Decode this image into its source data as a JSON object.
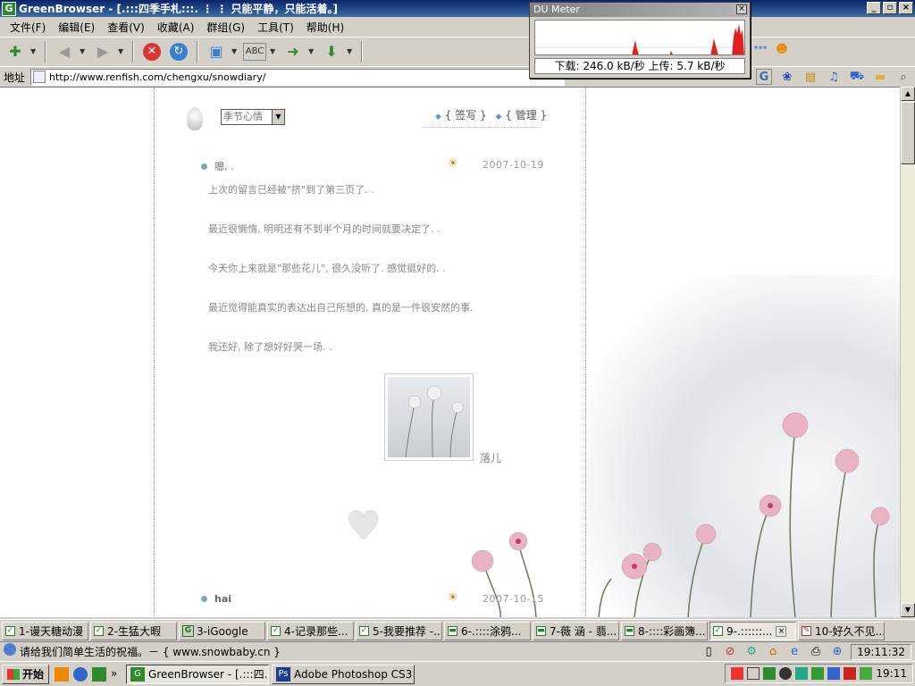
{
  "window": {
    "title": "GreenBrowser - [.:::四季手札:::.  ⋮ ⋮ 只能平静，只能活着。]",
    "app_icon": "G"
  },
  "menu": [
    "文件(F)",
    "编辑(E)",
    "查看(V)",
    "收藏(A)",
    "群组(G)",
    "工具(T)",
    "帮助(H)"
  ],
  "address": {
    "label": "地址",
    "url": "http://www.renfish.com/chengxu/snowdiary/"
  },
  "du_meter": {
    "title": "DU Meter",
    "stats": "下载: 246.0 kB/秒  上传: 5.7 kB/秒"
  },
  "diary": {
    "mood_select": "季节心情",
    "links": {
      "sign": "签写",
      "manage": "管理"
    },
    "post1": {
      "author": "嗯. .",
      "date": "2007-10-19",
      "lines": [
        "上次的留言已经被\"挤\"到了第三页了. .",
        "最近很懒惰, 明明还有不到半个月的时间就要决定了. .",
        "今天你上来就是\"那些花儿\", 很久没听了. 感觉挺好的. .",
        "最近觉得能真实的表达出自己所想的, 真的是一件很安然的事.",
        "我还好, 除了想好好哭一场. ."
      ],
      "caption": "落儿"
    },
    "post2": {
      "author": "hai",
      "date": "2007-10-15"
    }
  },
  "tabs": [
    {
      "label": "1-谩天糖动漫",
      "active": false
    },
    {
      "label": "2-生猛大暇",
      "active": false
    },
    {
      "label": "3-iGoogle",
      "active": false
    },
    {
      "label": "4-记录那些...",
      "active": false
    },
    {
      "label": "5-我要推荐 -...",
      "active": false
    },
    {
      "label": "6-.::::涂鸦...",
      "active": false
    },
    {
      "label": "7-薇 涵 - 翡...",
      "active": false
    },
    {
      "label": "8-::::彩画簿...",
      "active": false
    },
    {
      "label": "9-.::::::...",
      "active": true
    },
    {
      "label": "10-好久不见...",
      "active": false
    }
  ],
  "status": {
    "text": "请给我们简单生活的祝福。－ { www.snowbaby.cn }",
    "time": "19:11:32"
  },
  "taskbar": {
    "start": "开始",
    "tasks": [
      {
        "label": "GreenBrowser - [.:::四...",
        "active": true
      },
      {
        "label": "Adobe Photoshop CS3 E...",
        "active": false
      }
    ],
    "clock": "19:11"
  },
  "colors": {
    "titlebar": "#0a246a",
    "chrome": "#d4d0c8",
    "accent_green": "#2e8b2e"
  },
  "icons": [
    "new-tab-icon",
    "back-icon",
    "forward-icon",
    "stop-icon",
    "refresh-icon",
    "spell-icon",
    "search-icon",
    "home-icon",
    "sun-icon",
    "heart-icon"
  ]
}
